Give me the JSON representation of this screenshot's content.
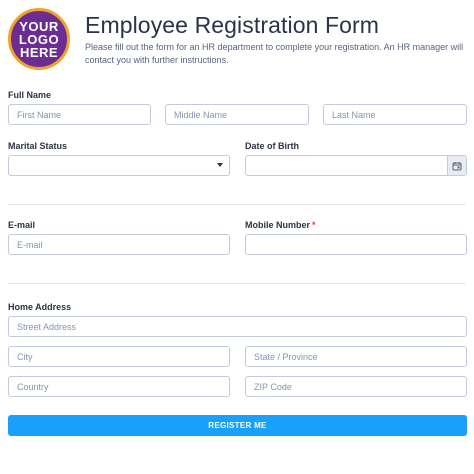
{
  "header": {
    "logo_lines": [
      "YOUR",
      "LOGO",
      "HERE"
    ],
    "title": "Employee Registration Form",
    "subtitle": "Please fill out the form for an HR department to complete your registration. An HR manager will contact you with further instructions."
  },
  "full_name": {
    "label": "Full Name",
    "first_placeholder": "First Name",
    "middle_placeholder": "Middle Name",
    "last_placeholder": "Last Name"
  },
  "marital_status": {
    "label": "Marital Status",
    "value": ""
  },
  "date_of_birth": {
    "label": "Date of Birth",
    "value": ""
  },
  "email": {
    "label": "E-mail",
    "placeholder": "E-mail"
  },
  "mobile": {
    "label": "Mobile Number",
    "required_mark": "*",
    "value": ""
  },
  "home_address": {
    "label": "Home Address",
    "street_placeholder": "Street Address",
    "city_placeholder": "City",
    "state_placeholder": "State / Province",
    "country_placeholder": "Country",
    "zip_placeholder": "ZIP Code"
  },
  "submit": {
    "label": "REGISTER ME"
  },
  "colors": {
    "logo_bg": "#6b2d91",
    "logo_ring": "#f0a32a",
    "button": "#18a0fb",
    "required": "#f23a3c"
  },
  "icons": {
    "select_caret": "caret-down-icon",
    "calendar": "calendar-icon"
  }
}
